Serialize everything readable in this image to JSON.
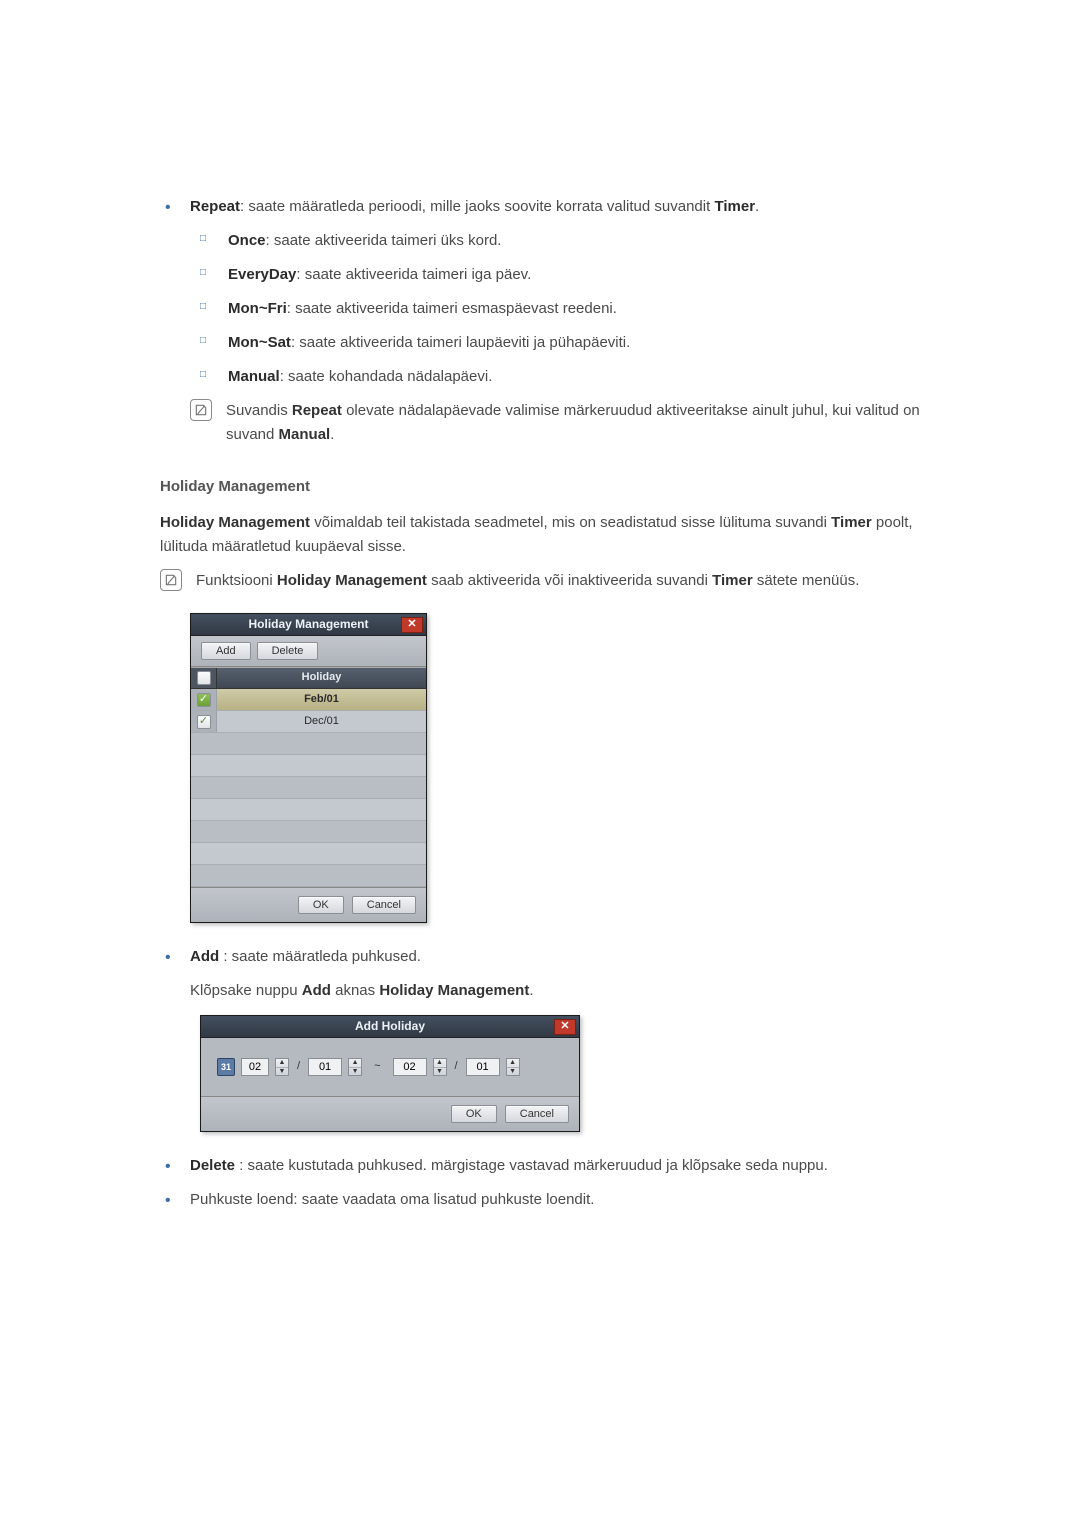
{
  "repeat": {
    "title": "Repeat",
    "desc": ": saate määratleda perioodi, mille jaoks soovite korrata valitud suvandit ",
    "timer_word": "Timer",
    "trail": ".",
    "items": [
      {
        "label": "Once",
        "desc": ": saate aktiveerida taimeri üks kord."
      },
      {
        "label": "EveryDay",
        "desc": ": saate aktiveerida taimeri iga päev."
      },
      {
        "label": "Mon~Fri",
        "desc": ": saate aktiveerida taimeri esmaspäevast reedeni."
      },
      {
        "label": "Mon~Sat",
        "desc": ": saate aktiveerida taimeri laupäeviti ja pühapäeviti."
      },
      {
        "label": "Manual",
        "desc": ": saate kohandada nädalapäevi."
      }
    ],
    "note_pre": "Suvandis ",
    "note_bold1": "Repeat",
    "note_mid": " olevate nädalapäevade valimise märkeruudud aktiveeritakse ainult juhul, kui valitud on suvand ",
    "note_bold2": "Manual",
    "note_trail": "."
  },
  "hm_section": {
    "heading": "Holiday Management",
    "p1_b": "Holiday Management",
    "p1_mid": " võimaldab teil takistada seadmetel, mis on seadistatud sisse lülituma suvandi ",
    "p1_timer": "Timer",
    "p1_trail": " poolt, lülituda määratletud kuupäeval sisse.",
    "note_pre": "Funktsiooni ",
    "note_b1": "Holiday Management",
    "note_mid": " saab aktiveerida või inaktiveerida suvandi ",
    "note_b2": "Timer",
    "note_trail": " sätete menüüs."
  },
  "hm_dialog": {
    "title": "Holiday Management",
    "add": "Add",
    "delete": "Delete",
    "col": "Holiday",
    "rows": [
      {
        "checked": true,
        "value": "Feb/01"
      },
      {
        "checked": false,
        "value": "Dec/01"
      }
    ],
    "ok": "OK",
    "cancel": "Cancel"
  },
  "add_desc": {
    "title": "Add",
    "tail": " : saate määratleda puhkused.",
    "line2_pre": "Klõpsake nuppu ",
    "line2_b1": "Add",
    "line2_mid": " aknas ",
    "line2_b2": "Holiday Management",
    "line2_trail": "."
  },
  "ah_dialog": {
    "title": "Add Holiday",
    "m1": "02",
    "d1": "01",
    "m2": "02",
    "d2": "01",
    "sep": "/",
    "range": "~",
    "ok": "OK",
    "cancel": "Cancel"
  },
  "delete_desc": {
    "title": "Delete",
    "tail": " : saate kustutada puhkused. märgistage vastavad märkeruudud ja klõpsake seda nuppu."
  },
  "list_desc": "Puhkuste loend: saate vaadata oma lisatud puhkuste loendit."
}
